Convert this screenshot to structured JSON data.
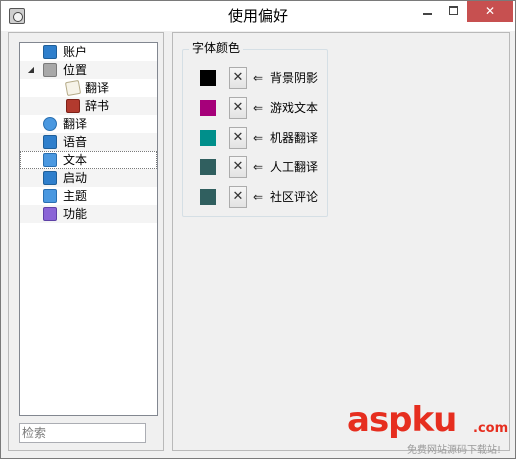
{
  "window": {
    "title": "使用偏好",
    "close_glyph": "✕"
  },
  "sidebar": {
    "items": [
      {
        "label": "账户",
        "icon": "user-icon"
      },
      {
        "label": "位置",
        "icon": "trash-location-icon",
        "expanded": true,
        "arrow": "◢"
      },
      {
        "label": "翻译",
        "icon": "paper-icon",
        "child": true
      },
      {
        "label": "辞书",
        "icon": "book-icon",
        "child": true
      },
      {
        "label": "翻译",
        "icon": "globe-icon"
      },
      {
        "label": "语音",
        "icon": "music-note-icon"
      },
      {
        "label": "文本",
        "icon": "document-icon",
        "selected": true
      },
      {
        "label": "启动",
        "icon": "app-store-icon"
      },
      {
        "label": "主题",
        "icon": "window-icon"
      },
      {
        "label": "功能",
        "icon": "gear-icon"
      }
    ],
    "search": {
      "placeholder": "检索",
      "value": ""
    }
  },
  "main": {
    "group_title": "字体颜色",
    "clear_glyph": "✕",
    "arrow_glyph": "⇐",
    "colors": [
      {
        "label": "背景阴影",
        "color": "#000000"
      },
      {
        "label": "游戏文本",
        "color": "#a6007a"
      },
      {
        "label": "机器翻译",
        "color": "#008f8b"
      },
      {
        "label": "人工翻译",
        "color": "#305f5f"
      },
      {
        "label": "社区评论",
        "color": "#305f5f"
      }
    ]
  },
  "watermark": {
    "main": "aspku",
    "suffix": ".com",
    "sub": "免费网站源码下载站!"
  }
}
